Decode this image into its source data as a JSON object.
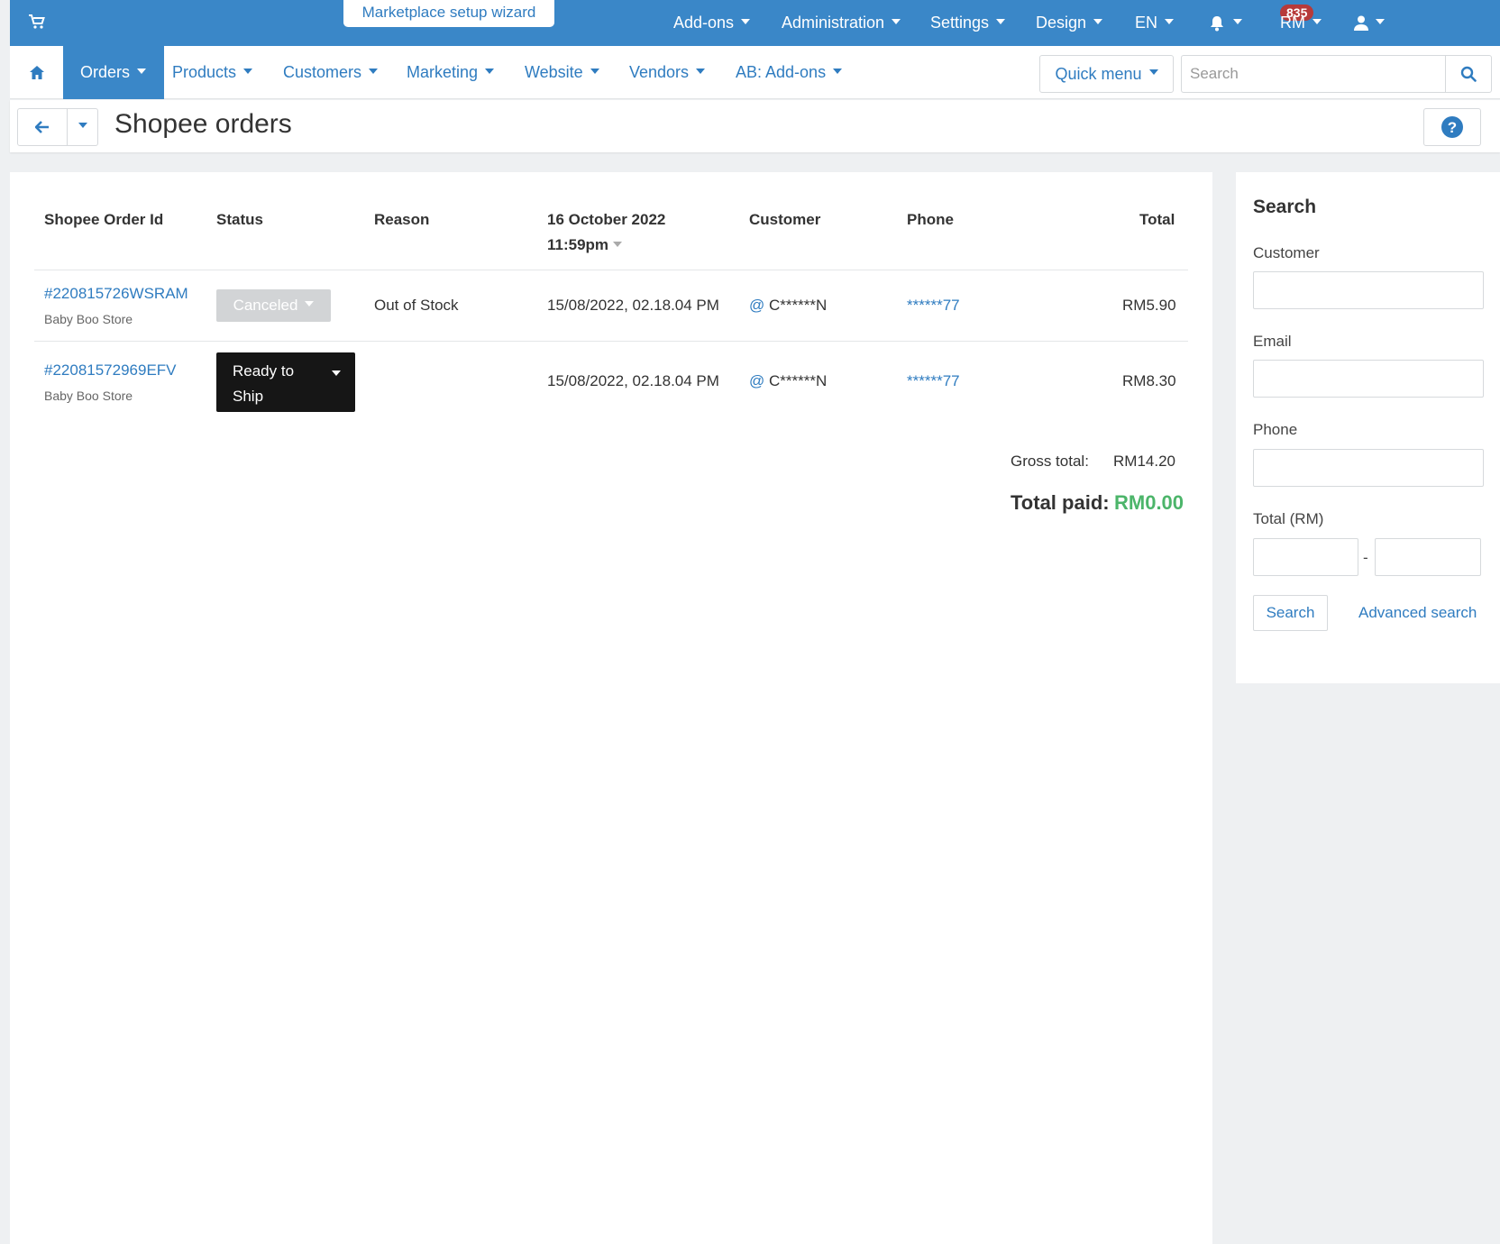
{
  "topbar": {
    "wizard": "Marketplace setup wizard",
    "menus": [
      "Add-ons",
      "Administration",
      "Settings",
      "Design",
      "EN"
    ],
    "notifications": "835",
    "currency": "RM"
  },
  "nav": {
    "items": [
      "Orders",
      "Products",
      "Customers",
      "Marketing",
      "Website",
      "Vendors",
      "AB: Add-ons"
    ],
    "quick_menu": "Quick menu",
    "search_placeholder": "Search"
  },
  "page": {
    "title": "Shopee orders"
  },
  "table": {
    "headers": {
      "order_id": "Shopee Order Id",
      "status": "Status",
      "reason": "Reason",
      "date_line1": "16 October 2022",
      "date_line2": "11:59pm",
      "customer": "Customer",
      "phone": "Phone",
      "total": "Total"
    },
    "rows": [
      {
        "order_id": "#220815726WSRAM",
        "store": "Baby Boo Store",
        "status": "Canceled",
        "reason": "Out of Stock",
        "date": "15/08/2022, 02.18.04 PM",
        "customer": "C******N",
        "phone": "******77",
        "total": "RM5.90"
      },
      {
        "order_id": "#22081572969EFV",
        "store": "Baby Boo Store",
        "status_line1": "Ready to",
        "status_line2": "Ship",
        "reason": "",
        "date": "15/08/2022, 02.18.04 PM",
        "customer": "C******N",
        "phone": "******77",
        "total": "RM8.30"
      }
    ]
  },
  "totals": {
    "gross_label": "Gross total:",
    "gross_value": "RM14.20",
    "paid_label": "Total paid:",
    "paid_value": "RM0.00",
    "paid_color": "#4cb56a"
  },
  "sidebar": {
    "title": "Search",
    "customer_label": "Customer",
    "email_label": "Email",
    "phone_label": "Phone",
    "total_label": "Total (RM)",
    "range_separator": "-",
    "search_button": "Search",
    "advanced_link": "Advanced search"
  },
  "colors": {
    "primary": "#3a87c8",
    "link": "#2f7cc0",
    "badge": "#b73a3a"
  }
}
